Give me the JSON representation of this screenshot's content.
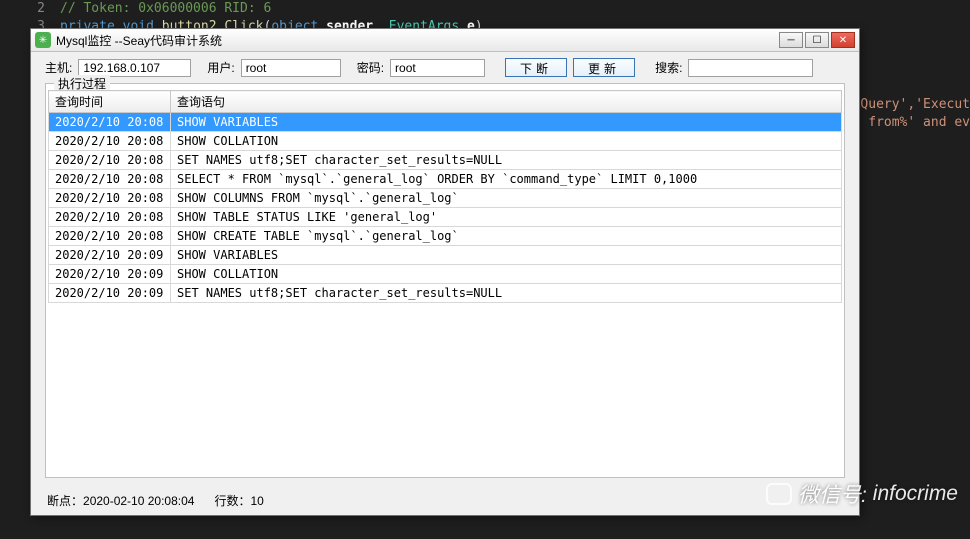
{
  "code": {
    "line2_no": "2",
    "line2_text": "// Token: 0x06000006 RID: 6",
    "line3_no": "3",
    "kw_private": "private",
    "kw_void": "void",
    "fn_name": "button2_Click",
    "kw_object": "object",
    "param1": "sender",
    "comma": ", ",
    "type2": "EventArgs",
    "param2": "e",
    "paren_close": ")",
    "paren_open": "(",
    "partial1": "Query','Execut",
    "partial2": " from%' and ev"
  },
  "window": {
    "title": "Mysql监控 --Seay代码审计系统"
  },
  "toolbar": {
    "host_label": "主机:",
    "host_value": "192.168.0.107",
    "user_label": "用户:",
    "user_value": "root",
    "pass_label": "密码:",
    "pass_value": "root",
    "btn_stop": "下断",
    "btn_refresh": "更新",
    "search_label": "搜索:",
    "search_value": ""
  },
  "group": {
    "title": "执行过程",
    "col_time": "查询时间",
    "col_sql": "查询语句",
    "rows": [
      {
        "time": "2020/2/10 20:08",
        "sql": "SHOW VARIABLES",
        "selected": true
      },
      {
        "time": "2020/2/10 20:08",
        "sql": "SHOW COLLATION"
      },
      {
        "time": "2020/2/10 20:08",
        "sql": "SET NAMES utf8;SET character_set_results=NULL"
      },
      {
        "time": "2020/2/10 20:08",
        "sql": "SELECT * FROM `mysql`.`general_log` ORDER BY `command_type`  LIMIT 0,1000"
      },
      {
        "time": "2020/2/10 20:08",
        "sql": "SHOW COLUMNS FROM `mysql`.`general_log`"
      },
      {
        "time": "2020/2/10 20:08",
        "sql": "SHOW TABLE STATUS LIKE 'general_log'"
      },
      {
        "time": "2020/2/10 20:08",
        "sql": "SHOW CREATE TABLE `mysql`.`general_log`"
      },
      {
        "time": "2020/2/10 20:09",
        "sql": "SHOW VARIABLES"
      },
      {
        "time": "2020/2/10 20:09",
        "sql": "SHOW COLLATION"
      },
      {
        "time": "2020/2/10 20:09",
        "sql": "SET NAMES utf8;SET character_set_results=NULL"
      }
    ]
  },
  "status": {
    "breakpoint_label": "断点：",
    "breakpoint_value": "2020-02-10 20:08:04",
    "rows_label": "行数：",
    "rows_value": "10"
  },
  "watermark": {
    "label": "微信号:",
    "value": "infocrime"
  }
}
